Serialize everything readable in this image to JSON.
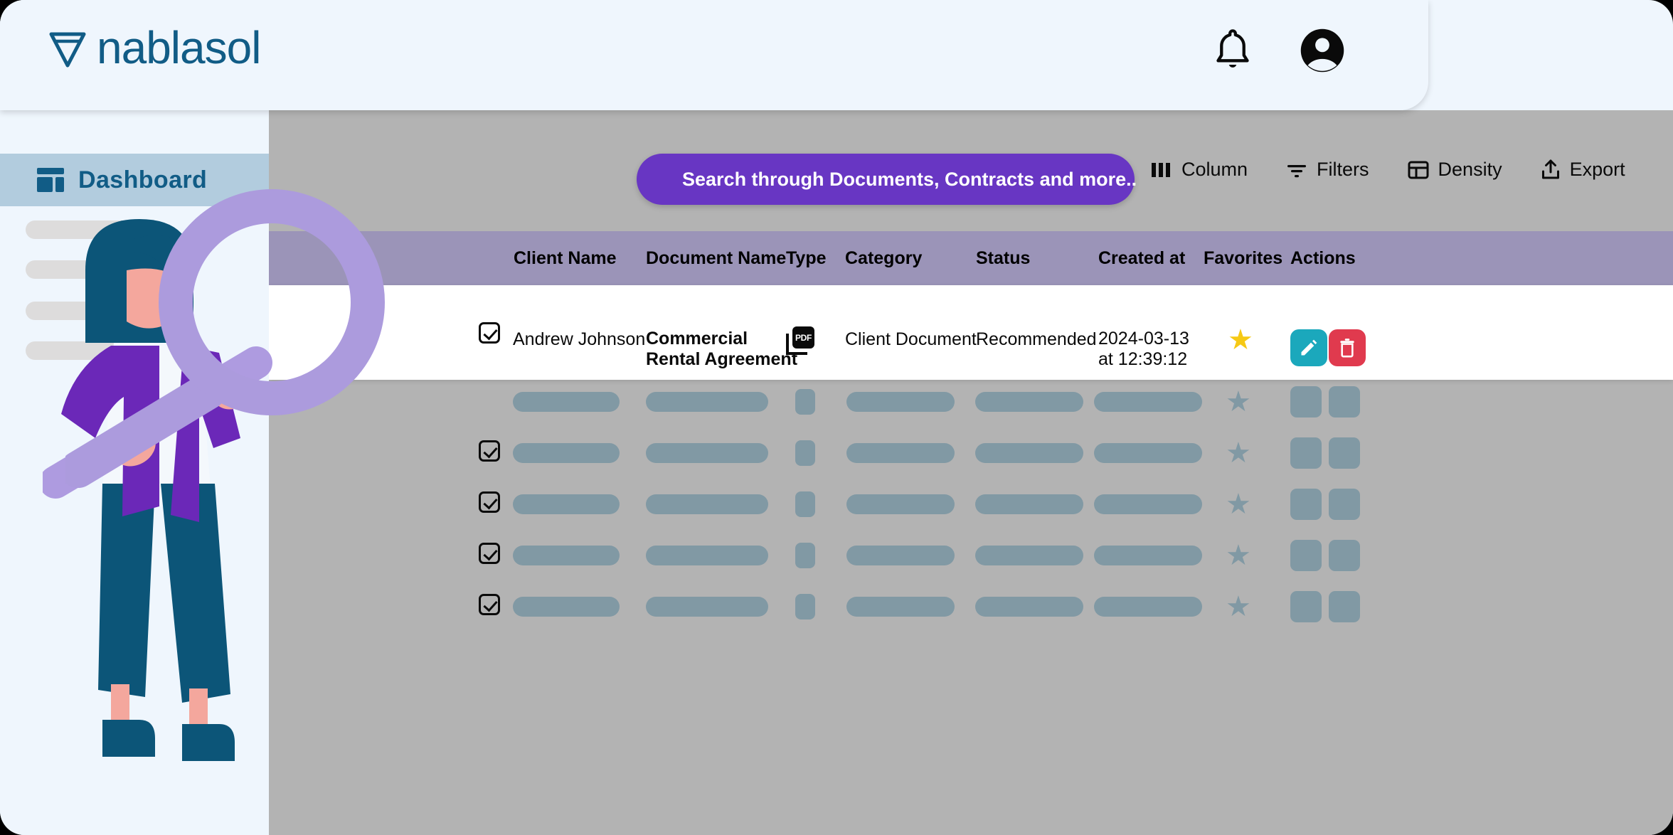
{
  "brand": {
    "name": "nablasol",
    "logo_icon": "nabla-icon",
    "color": "#115C86"
  },
  "header": {
    "notification_icon": "bell-icon",
    "avatar_icon": "account-circle-icon"
  },
  "sidebar": {
    "items": [
      {
        "label": "Dashboard",
        "icon": "dashboard-icon",
        "active": true
      }
    ],
    "placeholder_count": 4
  },
  "toolbar": {
    "search": {
      "placeholder": "Search through Documents, Contracts and more..",
      "icon": "search-icon",
      "color": "#6836C3"
    },
    "buttons": [
      {
        "label": "Column",
        "icon": "columns-icon"
      },
      {
        "label": "Filters",
        "icon": "filter-icon"
      },
      {
        "label": "Density",
        "icon": "density-icon"
      },
      {
        "label": "Export",
        "icon": "export-icon"
      }
    ]
  },
  "table": {
    "header_bg": "#9B94B8",
    "columns": [
      {
        "key": "select",
        "label": ""
      },
      {
        "key": "client_name",
        "label": "Client Name"
      },
      {
        "key": "document_name",
        "label": "Document Name"
      },
      {
        "key": "type",
        "label": "Type"
      },
      {
        "key": "category",
        "label": "Category"
      },
      {
        "key": "status",
        "label": "Status"
      },
      {
        "key": "created_at",
        "label": "Created at"
      },
      {
        "key": "favorites",
        "label": "Favorites"
      },
      {
        "key": "actions",
        "label": "Actions"
      }
    ],
    "rows": [
      {
        "selected": true,
        "client_name": "Andrew Johnson",
        "document_name_line1": "Commercial",
        "document_name_line2": "Rental Agreement",
        "type_icon": "pdf-icon",
        "category": "Client Document",
        "status": "Recommended",
        "created_date": "2024-03-13",
        "created_time": "at 12:39:12",
        "favorite": true,
        "favorite_icon": "star-filled-icon",
        "actions": [
          {
            "name": "edit",
            "icon": "pencil-icon",
            "color": "#1BA8BC"
          },
          {
            "name": "delete",
            "icon": "trash-icon",
            "color": "#E03A4E"
          }
        ]
      }
    ],
    "skeleton_row_count": 5
  },
  "illustration": {
    "name": "woman-with-magnifying-glass",
    "colors": {
      "hair_and_pants": "#0C5578",
      "jacket": "#6B28B8",
      "skin": "#F4A79D",
      "magnifier": "#AE9BE0"
    }
  },
  "overlay": {
    "magnifier_icon": "magnifying-glass-icon",
    "color": "#AC9BDD"
  }
}
